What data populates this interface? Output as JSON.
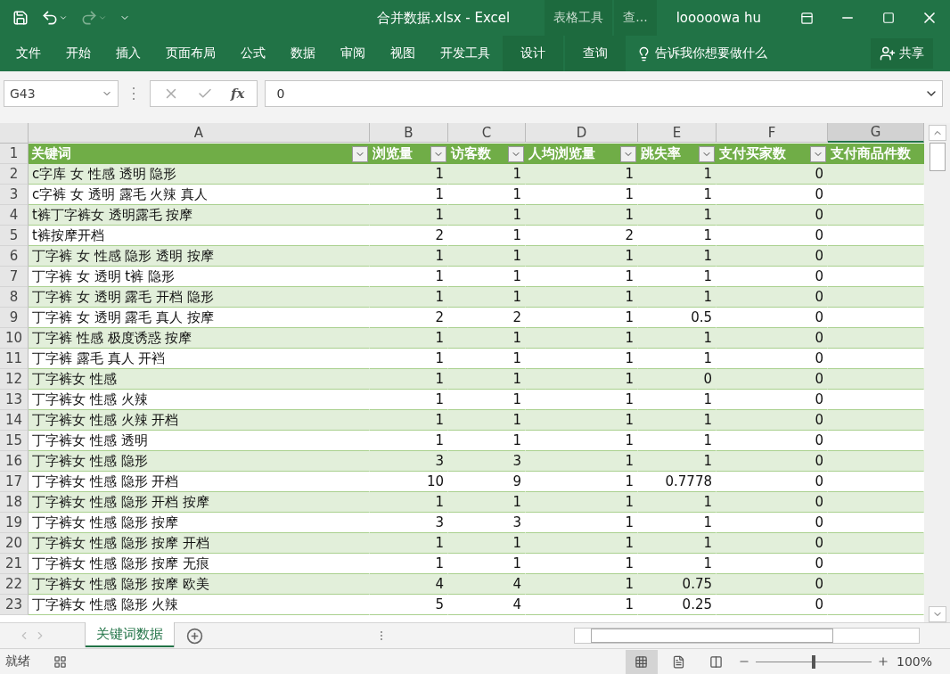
{
  "title_bar": {
    "file_title": "合并数据.xlsx  -  Excel",
    "contextual_tabs": [
      "表格工具",
      "查..."
    ],
    "user": "looooowa hu"
  },
  "ribbon_tabs": [
    {
      "label": "文件",
      "kind": "normal"
    },
    {
      "label": "开始",
      "kind": "normal"
    },
    {
      "label": "插入",
      "kind": "normal"
    },
    {
      "label": "页面布局",
      "kind": "normal"
    },
    {
      "label": "公式",
      "kind": "normal"
    },
    {
      "label": "数据",
      "kind": "normal"
    },
    {
      "label": "审阅",
      "kind": "normal"
    },
    {
      "label": "视图",
      "kind": "normal"
    },
    {
      "label": "开发工具",
      "kind": "normal"
    },
    {
      "label": "设计",
      "kind": "contextual"
    },
    {
      "label": "查询",
      "kind": "contextual"
    }
  ],
  "tell_me": {
    "placeholder": "告诉我你想要做什么"
  },
  "share_button": "共享",
  "formula_bar": {
    "name_box": "G43",
    "fx": "fx",
    "value": "0"
  },
  "sheet": {
    "columns": [
      {
        "letter": "A",
        "selected": false
      },
      {
        "letter": "B",
        "selected": false
      },
      {
        "letter": "C",
        "selected": false
      },
      {
        "letter": "D",
        "selected": false
      },
      {
        "letter": "E",
        "selected": false
      },
      {
        "letter": "F",
        "selected": false
      },
      {
        "letter": "G",
        "selected": true
      }
    ],
    "header_row": {
      "number": "1",
      "cells": [
        {
          "label": "关键词",
          "filter": true
        },
        {
          "label": "浏览量",
          "filter": true
        },
        {
          "label": "访客数",
          "filter": true
        },
        {
          "label": "人均浏览量",
          "filter": true
        },
        {
          "label": "跳失率",
          "filter": true
        },
        {
          "label": "支付买家数",
          "filter": true
        },
        {
          "label": "支付商品件数",
          "filter": false
        }
      ]
    },
    "rows": [
      {
        "number": "2",
        "cells": [
          "c字库 女 性感 透明 隐形",
          "1",
          "1",
          "1",
          "1",
          "0"
        ]
      },
      {
        "number": "3",
        "cells": [
          "c字裤 女 透明 露毛 火辣 真人",
          "1",
          "1",
          "1",
          "1",
          "0"
        ]
      },
      {
        "number": "4",
        "cells": [
          "t裤丁字裤女 透明露毛 按摩",
          "1",
          "1",
          "1",
          "1",
          "0"
        ]
      },
      {
        "number": "5",
        "cells": [
          "t裤按摩开档",
          "2",
          "1",
          "2",
          "1",
          "0"
        ]
      },
      {
        "number": "6",
        "cells": [
          "丁字裤 女 性感 隐形 透明 按摩",
          "1",
          "1",
          "1",
          "1",
          "0"
        ]
      },
      {
        "number": "7",
        "cells": [
          "丁字裤 女 透明 t裤 隐形",
          "1",
          "1",
          "1",
          "1",
          "0"
        ]
      },
      {
        "number": "8",
        "cells": [
          "丁字裤 女 透明 露毛 开档 隐形",
          "1",
          "1",
          "1",
          "1",
          "0"
        ]
      },
      {
        "number": "9",
        "cells": [
          "丁字裤 女 透明 露毛 真人 按摩",
          "2",
          "2",
          "1",
          "0.5",
          "0"
        ]
      },
      {
        "number": "10",
        "cells": [
          "丁字裤 性感 极度诱惑 按摩",
          "1",
          "1",
          "1",
          "1",
          "0"
        ]
      },
      {
        "number": "11",
        "cells": [
          "丁字裤 露毛 真人 开裆",
          "1",
          "1",
          "1",
          "1",
          "0"
        ]
      },
      {
        "number": "12",
        "cells": [
          "丁字裤女 性感",
          "1",
          "1",
          "1",
          "0",
          "0"
        ]
      },
      {
        "number": "13",
        "cells": [
          "丁字裤女 性感 火辣",
          "1",
          "1",
          "1",
          "1",
          "0"
        ]
      },
      {
        "number": "14",
        "cells": [
          "丁字裤女 性感 火辣 开档",
          "1",
          "1",
          "1",
          "1",
          "0"
        ]
      },
      {
        "number": "15",
        "cells": [
          "丁字裤女 性感 透明",
          "1",
          "1",
          "1",
          "1",
          "0"
        ]
      },
      {
        "number": "16",
        "cells": [
          "丁字裤女 性感 隐形",
          "3",
          "3",
          "1",
          "1",
          "0"
        ]
      },
      {
        "number": "17",
        "cells": [
          "丁字裤女 性感 隐形 开档",
          "10",
          "9",
          "1",
          "0.7778",
          "0"
        ]
      },
      {
        "number": "18",
        "cells": [
          "丁字裤女 性感 隐形 开档 按摩",
          "1",
          "1",
          "1",
          "1",
          "0"
        ]
      },
      {
        "number": "19",
        "cells": [
          "丁字裤女 性感 隐形 按摩",
          "3",
          "3",
          "1",
          "1",
          "0"
        ]
      },
      {
        "number": "20",
        "cells": [
          "丁字裤女 性感 隐形 按摩 开档",
          "1",
          "1",
          "1",
          "1",
          "0"
        ]
      },
      {
        "number": "21",
        "cells": [
          "丁字裤女 性感 隐形 按摩 无痕",
          "1",
          "1",
          "1",
          "1",
          "0"
        ]
      },
      {
        "number": "22",
        "cells": [
          "丁字裤女 性感 隐形 按摩 欧美",
          "4",
          "4",
          "1",
          "0.75",
          "0"
        ]
      },
      {
        "number": "23",
        "cells": [
          "丁字裤女 性感 隐形 火辣",
          "5",
          "4",
          "1",
          "0.25",
          "0"
        ]
      }
    ]
  },
  "sheet_tabs": [
    {
      "label": "关键词数据",
      "selected": true
    }
  ],
  "status_bar": {
    "status": "就绪",
    "views": [
      {
        "kind": "normal",
        "selected": true
      },
      {
        "kind": "page-layout",
        "selected": false
      },
      {
        "kind": "page-break",
        "selected": false
      }
    ],
    "zoom_slider": {
      "level": 0.5
    },
    "zoom": "100%"
  }
}
